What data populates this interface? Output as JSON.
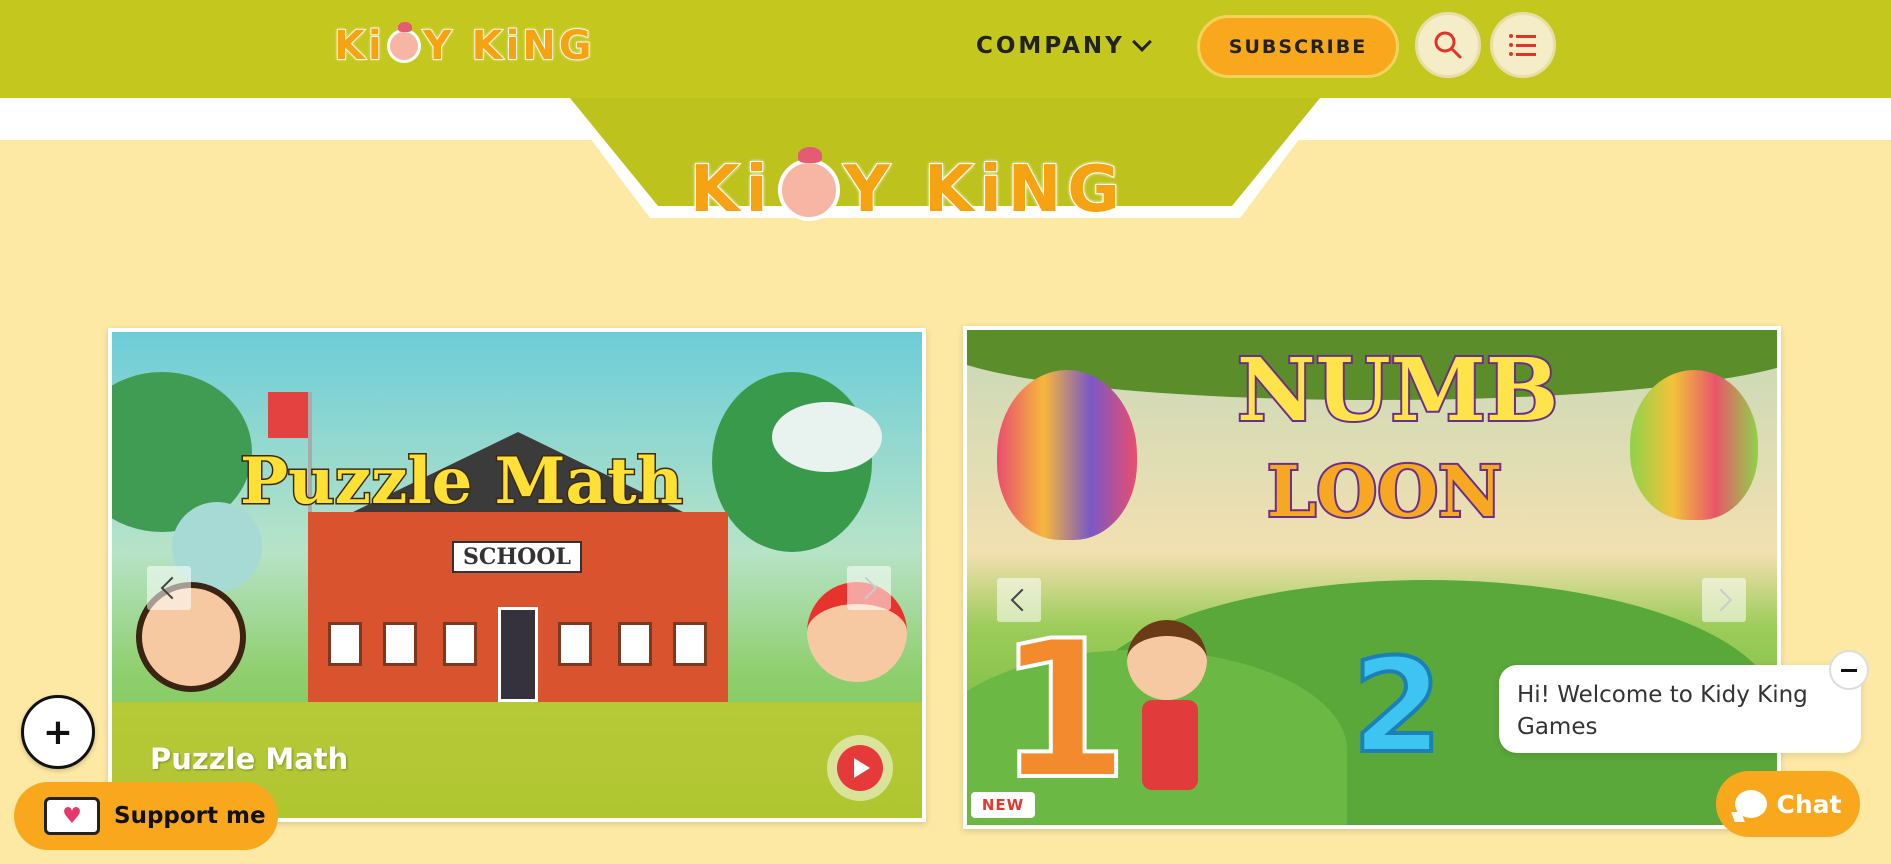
{
  "header": {
    "logo_text": "KiDY KiNG",
    "nav_company": "COMPANY",
    "subscribe_label": "SUBSCRIBE",
    "search_icon": "search-icon",
    "menu_icon": "list-menu-icon"
  },
  "banner": {
    "logo_text": "KiDY KiNG"
  },
  "cards": [
    {
      "title_art": "Puzzle Math",
      "sign_art": "SCHOOL",
      "caption": "Puzzle Math",
      "play_icon": "play-icon"
    },
    {
      "title_art_line1": "NUMB",
      "title_art_line2": "LOON",
      "badge": "NEW"
    }
  ],
  "widgets": {
    "support_label": "Support me",
    "chat_popup": "Hi! Welcome to Kidy King Games",
    "chat_label": "Chat"
  },
  "colors": {
    "topbar": "#c4c81e",
    "background": "#fde9a4",
    "accent_orange": "#f9a81d",
    "logo_orange": "#f5a312"
  }
}
